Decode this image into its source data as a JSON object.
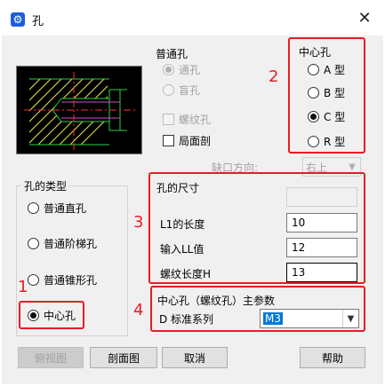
{
  "window": {
    "title": "孔",
    "app_icon": "gear-icon",
    "close_glyph": "✕"
  },
  "normal_hole": {
    "label": "普通孔",
    "options": [
      {
        "label": "通孔",
        "checked": true,
        "enabled": false
      },
      {
        "label": "盲孔",
        "checked": false,
        "enabled": false
      }
    ],
    "thread_hole": {
      "label": "螺纹孔",
      "checked": false,
      "enabled": false
    },
    "partial_section": {
      "label": "局面剖",
      "checked": false,
      "enabled": true
    }
  },
  "center_hole": {
    "label": "中心孔",
    "options": [
      {
        "label": "A 型",
        "checked": false
      },
      {
        "label": "B 型",
        "checked": false
      },
      {
        "label": "C 型",
        "checked": true
      },
      {
        "label": "R 型",
        "checked": false
      }
    ]
  },
  "notch": {
    "label": "缺口方向:",
    "value": "右上"
  },
  "hole_type": {
    "label": "孔的类型",
    "options": [
      {
        "label": "普通直孔",
        "checked": false
      },
      {
        "label": "普通阶梯孔",
        "checked": false
      },
      {
        "label": "普通锥形孔",
        "checked": false
      },
      {
        "label": "中心孔",
        "checked": true
      }
    ]
  },
  "hole_size": {
    "label": "孔的尺寸",
    "top_value": "",
    "fields": [
      {
        "label": "L1的长度",
        "value": "10"
      },
      {
        "label": "输入LL值",
        "value": "12"
      },
      {
        "label": "螺纹长度H",
        "value": "13"
      }
    ]
  },
  "main_params": {
    "label": "中心孔（螺纹孔）主参数",
    "series_label": "D 标准系列",
    "series_value": "M3"
  },
  "annotations": [
    "1",
    "2",
    "3",
    "4"
  ],
  "buttons": {
    "top_view": "俯视图",
    "section_view": "剖面图",
    "cancel": "取消",
    "help": "帮助"
  },
  "colors": {
    "annotation_red": "#e81c24",
    "selection_blue": "#0078d7",
    "preview_bg": "#000000"
  }
}
